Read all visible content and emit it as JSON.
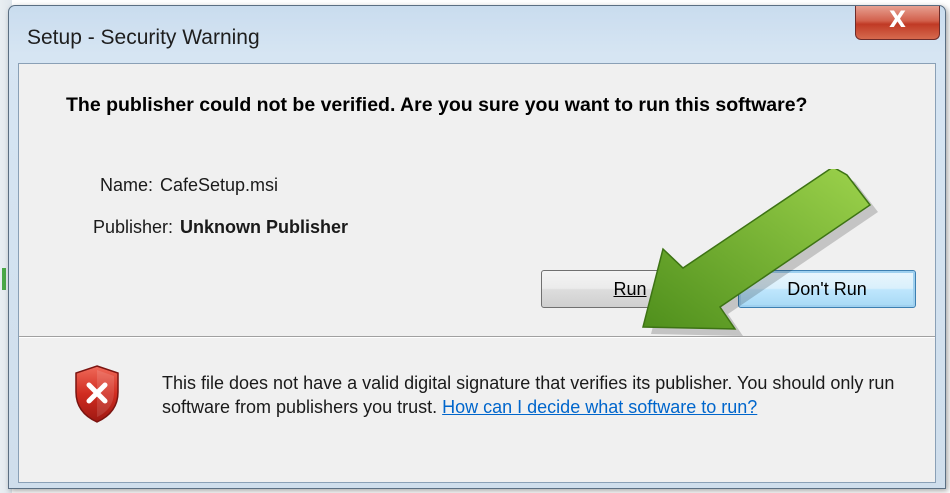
{
  "window": {
    "title": "Setup - Security Warning",
    "close_glyph": "X"
  },
  "dialog": {
    "headline": "The publisher could not be verified.  Are you sure you want to run this software?",
    "name_label": "Name:",
    "name_value": "CafeSetup.msi",
    "publisher_label": "Publisher:",
    "publisher_value": "Unknown Publisher"
  },
  "buttons": {
    "run_label": "Run",
    "dont_run_label": "Don't Run"
  },
  "footer": {
    "warning_text": "This file does not have a valid digital signature that verifies its publisher. You should only run software from publishers you trust.",
    "link_text": "How can I decide what software to run?"
  },
  "icons": {
    "shield": "shield-error-icon",
    "close": "close-icon",
    "arrow": "green-arrow-annotation"
  },
  "colors": {
    "shield_red": "#c8231b",
    "arrow_green": "#6aaa2b",
    "link_blue": "#0066cc"
  }
}
